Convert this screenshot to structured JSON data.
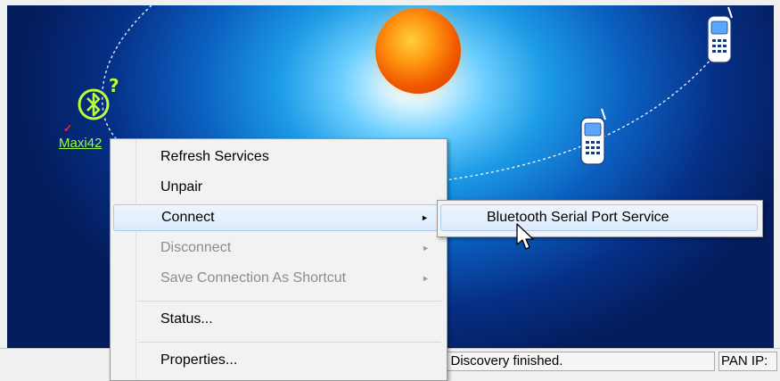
{
  "device": {
    "label": "Maxi42",
    "check": "✓",
    "unknown_mark": "?"
  },
  "menu": {
    "items": [
      {
        "label": "Refresh Services",
        "state": "normal"
      },
      {
        "label": "Unpair",
        "state": "normal"
      },
      {
        "label": "Connect",
        "state": "hover",
        "submenu": true
      },
      {
        "label": "Disconnect",
        "state": "disabled",
        "submenu": true
      },
      {
        "label": "Save Connection As Shortcut",
        "state": "disabled",
        "submenu": true
      },
      {
        "label": "Status...",
        "state": "normal"
      },
      {
        "label": "Properties...",
        "state": "normal"
      }
    ],
    "arrow_glyph": "►"
  },
  "submenu": {
    "items": [
      {
        "label": "Bluetooth Serial Port Service",
        "state": "hover"
      }
    ]
  },
  "statusbar": {
    "message": "e Discovery finished.",
    "pan_ip": "PAN IP:"
  },
  "colors": {
    "sky_dark": "#041d5c",
    "sky_light": "#6fd0ff",
    "sun": "#ff9a12",
    "device_label": "#9dff45",
    "menu_hover": "#dcebfc"
  },
  "icons": [
    "bluetooth-icon",
    "phone-icon",
    "sun-icon",
    "question-icon",
    "check-icon",
    "submenu-arrow-icon",
    "mouse-cursor-icon"
  ]
}
